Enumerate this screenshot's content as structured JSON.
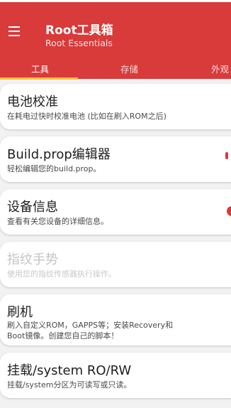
{
  "app_bar": {
    "title": "Root工具箱",
    "subtitle": "Root Essentials",
    "menu_icon": "hamburger-menu-icon",
    "color": "#d93a3a"
  },
  "tabs": [
    {
      "label": "工具",
      "selected": true
    },
    {
      "label": "存储",
      "selected": false
    },
    {
      "label": "外观",
      "selected": false
    }
  ],
  "tab_indicator_color": "#f5c342",
  "items": [
    {
      "title": "电池校准",
      "description": "在耗电过快时校准电池 (比如在刷入ROM之后)",
      "enabled": true
    },
    {
      "title": "Build.prop编辑器",
      "description": "轻松编辑您的build.prop。",
      "enabled": true
    },
    {
      "title": "设备信息",
      "description": "查看有关您设备的详细信息。",
      "enabled": true
    },
    {
      "title": "指纹手势",
      "description": "使用您的指纹传感器执行操作。",
      "enabled": false
    },
    {
      "title": "刷机",
      "description_lines": [
        "刷入自定义ROM，GAPPS等；安装Recovery和",
        "Boot镜像。创建您自己的脚本！"
      ],
      "enabled": true
    },
    {
      "title": "挂载/system RO/RW",
      "description": "挂载/system分区为可读写或只读。",
      "enabled": true
    }
  ]
}
